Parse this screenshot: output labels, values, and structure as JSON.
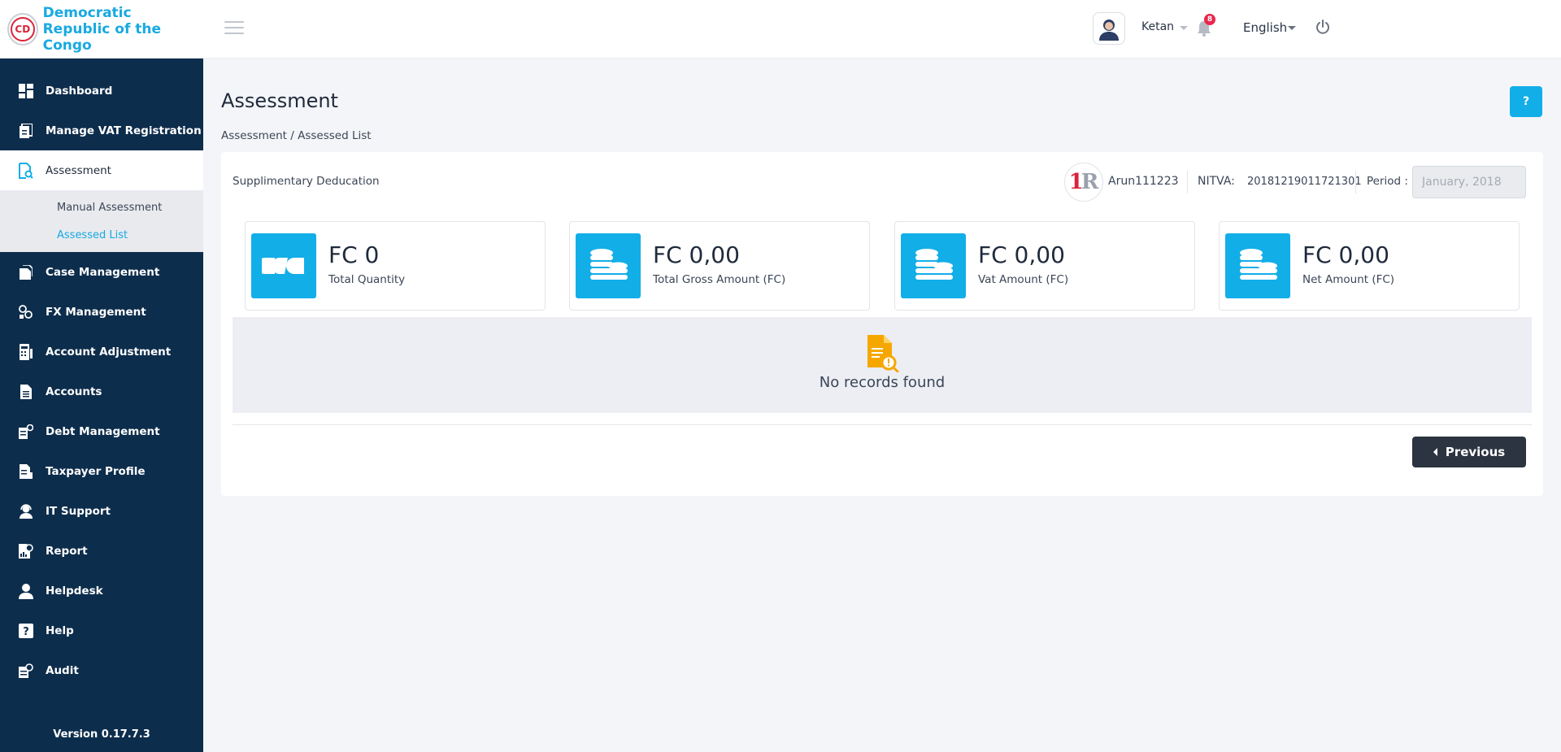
{
  "brand": {
    "name_line1": "Democratic",
    "name_line2": "Republic of the Congo",
    "logo_text": "CD"
  },
  "sidebar": {
    "items": [
      {
        "label": "Dashboard",
        "icon": "dashboard-icon"
      },
      {
        "label": "Manage VAT Registration",
        "icon": "registration-icon"
      },
      {
        "label": "Assessment",
        "icon": "assessment-icon",
        "active": true
      },
      {
        "label": "Case Management",
        "icon": "case-icon"
      },
      {
        "label": "FX Management",
        "icon": "fx-icon"
      },
      {
        "label": "Account Adjustment",
        "icon": "adjustment-icon"
      },
      {
        "label": "Accounts",
        "icon": "accounts-icon"
      },
      {
        "label": "Debt Management",
        "icon": "debt-icon"
      },
      {
        "label": "Taxpayer Profile",
        "icon": "profile-icon"
      },
      {
        "label": "IT Support",
        "icon": "support-icon"
      },
      {
        "label": "Report",
        "icon": "report-icon"
      },
      {
        "label": "Helpdesk",
        "icon": "helpdesk-icon"
      },
      {
        "label": "Help",
        "icon": "help-icon"
      },
      {
        "label": "Audit",
        "icon": "audit-icon"
      }
    ],
    "submenu": [
      {
        "label": "Manual Assessment"
      },
      {
        "label": "Assessed List",
        "active": true
      }
    ],
    "version": "Version 0.17.7.3"
  },
  "topbar": {
    "user_name": "Ketan",
    "notification_count": "8",
    "language": "English"
  },
  "page": {
    "title": "Assessment",
    "help_label": "?",
    "breadcrumb": "Assessment / Assessed List"
  },
  "card": {
    "title": "Supplimentary Deducation",
    "taxpayer_name": "Arun111223",
    "nitva_label": "NITVA:",
    "nitva_value": "20181219011721301",
    "period_label": "Period :",
    "period_value": "January, 2018"
  },
  "stats": [
    {
      "value": "FC 0",
      "label": "Total Quantity",
      "icon": "quantity-icon"
    },
    {
      "value": "FC 0,00",
      "label": "Total Gross Amount (FC)",
      "icon": "coins-icon"
    },
    {
      "value": "FC 0,00",
      "label": "Vat Amount (FC)",
      "icon": "coins-icon"
    },
    {
      "value": "FC 0,00",
      "label": "Net Amount (FC)",
      "icon": "coins-icon"
    }
  ],
  "empty_state": {
    "message": "No records found"
  },
  "pagination": {
    "previous_label": "Previous"
  },
  "colors": {
    "sidebar": "#0d2d4c",
    "accent": "#12aee8",
    "empty_icon": "#f5a700"
  }
}
